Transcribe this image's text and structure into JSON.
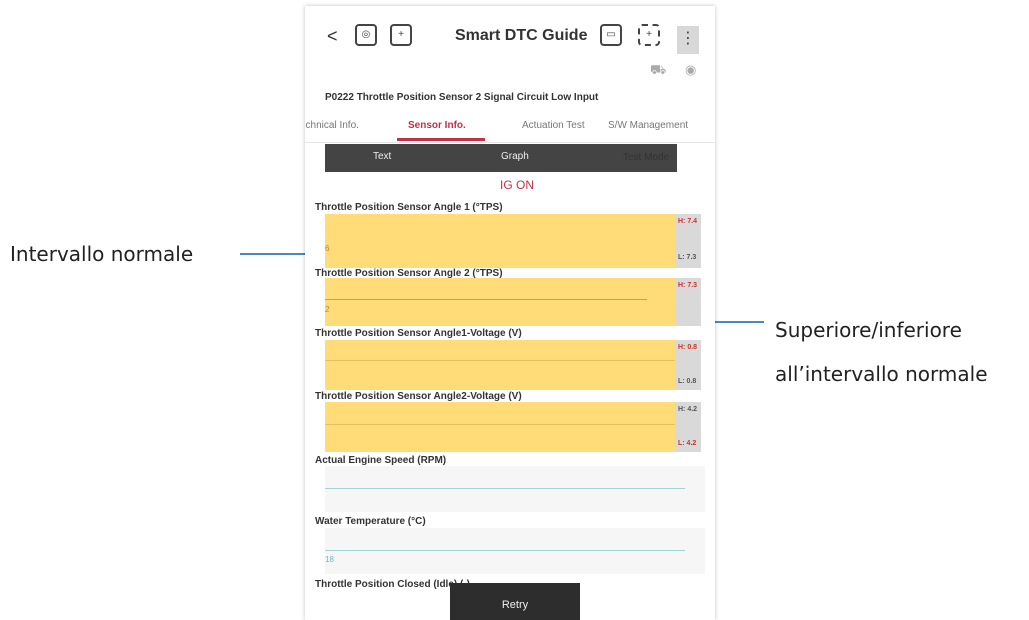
{
  "header": {
    "back": "<",
    "title": "Smart DTC Guide",
    "menu": "⋮"
  },
  "dtc_title": "P0222 Throttle Position Sensor 2 Signal Circuit Low Input",
  "tabs": [
    {
      "label": "Technical Info.",
      "active": false
    },
    {
      "label": "Sensor Info.",
      "active": true
    },
    {
      "label": "Actuation Test",
      "active": false
    },
    {
      "label": "S/W Management",
      "active": false
    }
  ],
  "view_modes": [
    "Text",
    "Graph",
    "Test Mode"
  ],
  "selected_view": "Graph",
  "status": "IG ON",
  "sensors": [
    {
      "label": "Throttle Position Sensor Angle 1 (°TPS)",
      "high": "H: 7.4",
      "low": "L: 7.3",
      "value": "6"
    },
    {
      "label": "Throttle Position Sensor Angle 2 (°TPS)",
      "high": "H: 7.3",
      "low": "",
      "value": "2"
    },
    {
      "label": "Throttle Position Sensor Angle1-Voltage (V)",
      "high": "H: 0.8",
      "low": "L: 0.8",
      "value": ""
    },
    {
      "label": "Throttle Position Sensor Angle2-Voltage (V)",
      "high": "H: 4.2",
      "low": "L: 4.2",
      "value": ""
    },
    {
      "label": "Actual Engine Speed (RPM)",
      "value": ""
    },
    {
      "label": "Water Temperature (°C)",
      "value": "18"
    },
    {
      "label": "Throttle Position Closed (Idle) (-)",
      "value": ""
    }
  ],
  "retry_label": "Retry",
  "callouts": {
    "normal_range": "Intervallo normale",
    "out_of_range_line1": "Superiore/inferiore",
    "out_of_range_line2": "all’intervallo normale"
  },
  "colors": {
    "accent": "#c0314a",
    "band_normal": "#ffdc78",
    "callout": "#4a86c8"
  }
}
